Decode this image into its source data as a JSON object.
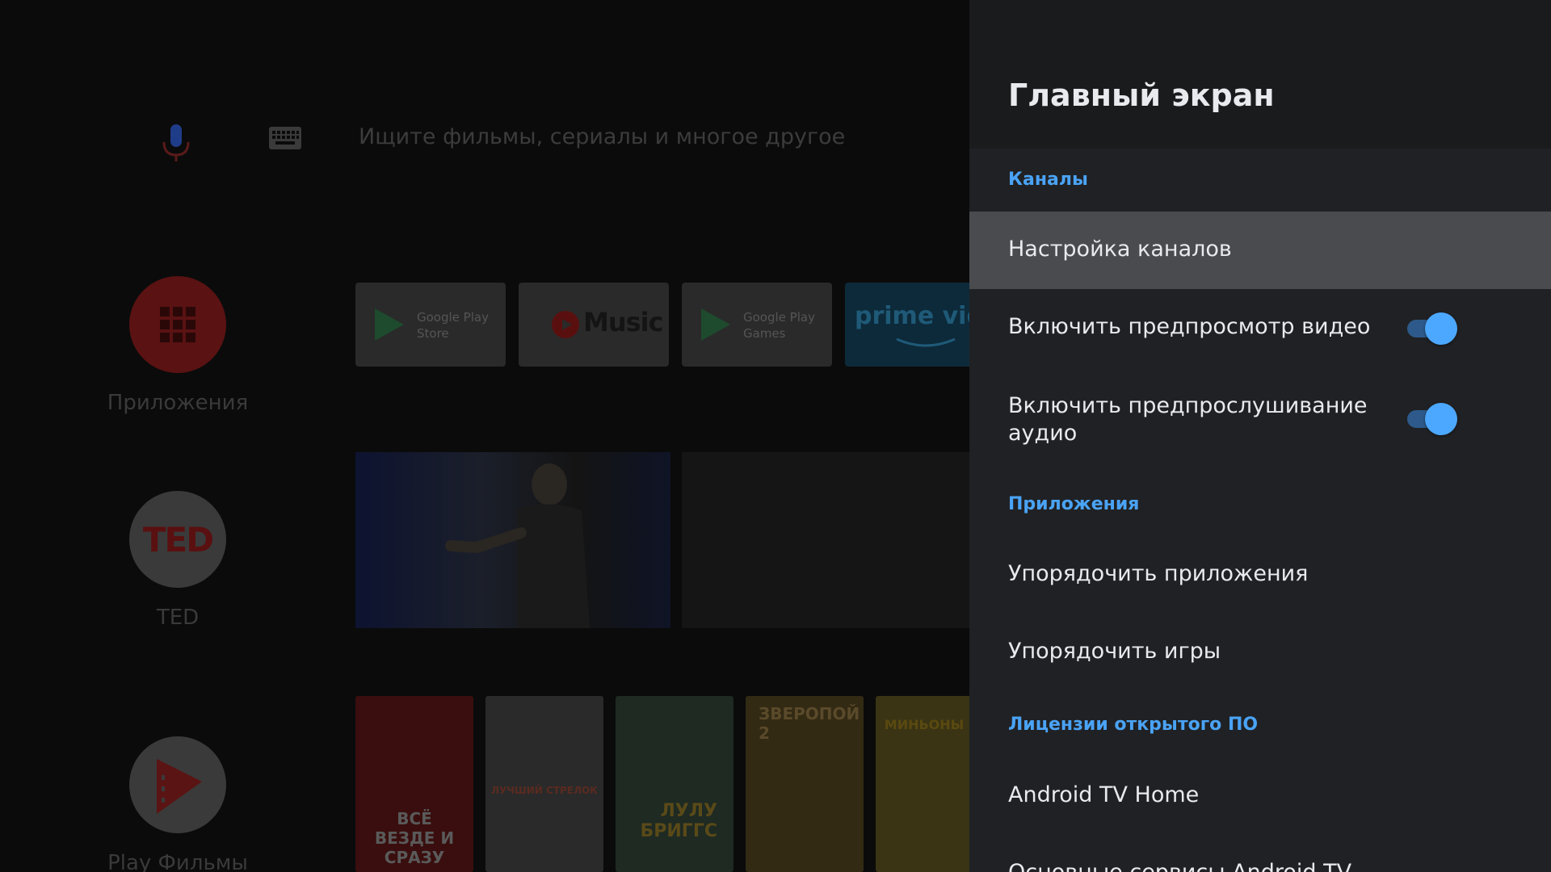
{
  "home": {
    "search_placeholder": "Ищите фильмы, сериалы и многое другое",
    "side_apps": [
      {
        "label": "Приложения",
        "icon": "apps-grid-icon",
        "color": "#c62828"
      },
      {
        "label": "TED",
        "icon": "ted-logo",
        "logo_text": "TED",
        "color": "#e8e8e8"
      },
      {
        "label": "Play Фильмы",
        "icon": "play-movies-icon",
        "color": "#e8e8e8"
      }
    ],
    "favorites": [
      {
        "name": "Google Play Store",
        "line1": "Google Play",
        "line2": "Store"
      },
      {
        "name": "YouTube Music",
        "text": "Music"
      },
      {
        "name": "Google Play Games",
        "line1": "Google Play",
        "line2": "Games"
      },
      {
        "name": "Prime Video",
        "text": "prime vide"
      }
    ],
    "posters": [
      {
        "title": "ВСЁ ВЕЗДЕ И СРАЗУ",
        "color": "#5a1414"
      },
      {
        "title": "ЛУЧШИЙ СТРЕЛОК",
        "color": "#3a3a3a"
      },
      {
        "title": "ЛУЛУ БРИГГС",
        "color": "#2b3a2e"
      },
      {
        "title": "ЗВЕРОПОЙ 2",
        "color": "#4a3a18"
      },
      {
        "title": "МИНЬОНЫ",
        "color": "#5a5020"
      }
    ]
  },
  "panel": {
    "title": "Главный экран",
    "sections": {
      "channels": "Каналы",
      "apps": "Приложения",
      "licenses": "Лицензии открытого ПО"
    },
    "items": {
      "channel_settings": "Настройка каналов",
      "video_preview": "Включить предпросмотр видео",
      "audio_preview_line1": "Включить предпрослушивание",
      "audio_preview_line2": "аудио",
      "sort_apps": "Упорядочить приложения",
      "sort_games": "Упорядочить игры",
      "android_tv_home": "Android TV Home",
      "core_services": "Основные сервисы Android TV"
    },
    "toggles": {
      "video_preview_on": true,
      "audio_preview_on": true
    },
    "colors": {
      "accent": "#4aa3f5",
      "focused_row": "#4a4b4e"
    }
  }
}
